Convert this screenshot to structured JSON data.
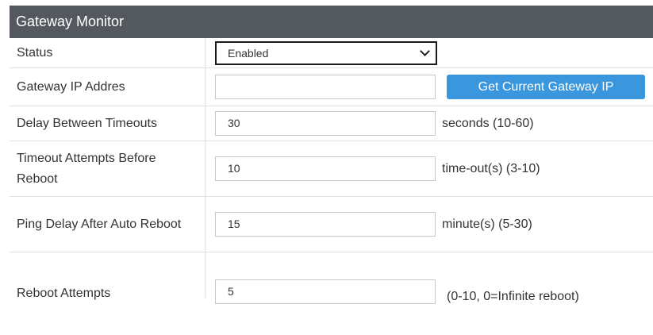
{
  "panel": {
    "title": "Gateway Monitor"
  },
  "rows": {
    "status": {
      "label": "Status",
      "selected": "Enabled"
    },
    "gateway_ip": {
      "label": "Gateway IP Addres",
      "value": "",
      "button_label": "Get Current Gateway IP"
    },
    "delay_between_timeouts": {
      "label": "Delay Between Timeouts",
      "value": "30",
      "unit": "seconds (10-60)"
    },
    "timeout_attempts": {
      "label": "Timeout Attempts Before Reboot",
      "value": "10",
      "unit": "time-out(s) (3-10)"
    },
    "ping_delay": {
      "label": "Ping Delay After Auto Reboot",
      "value": "15",
      "unit": "minute(s) (5-30)"
    },
    "reboot_attempts": {
      "label": "Reboot Attempts",
      "value": "5",
      "unit": "(0-10, 0=Infinite reboot)"
    }
  },
  "colors": {
    "header_bg": "#545960",
    "button_bg": "#3a96dd"
  }
}
